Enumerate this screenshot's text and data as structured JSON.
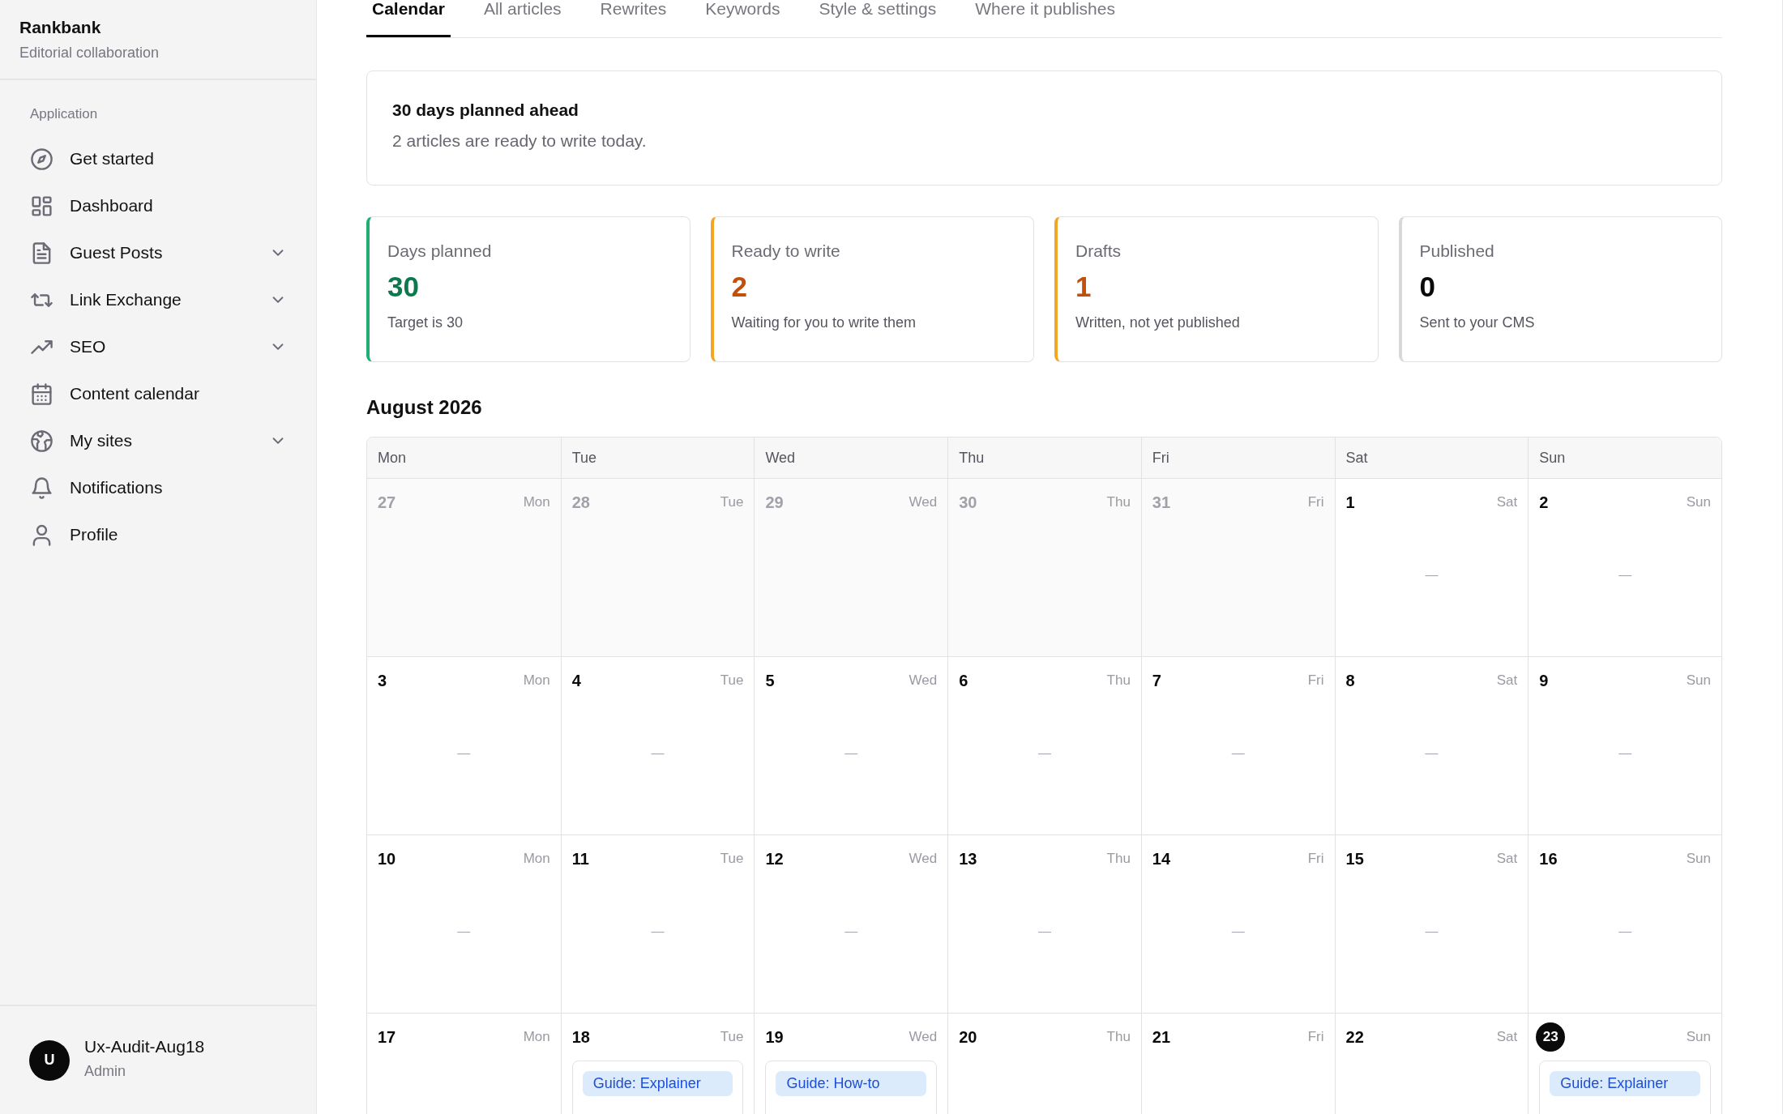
{
  "sidebar": {
    "brand": "Rankbank",
    "subtitle": "Editorial collaboration",
    "section": "Application",
    "items": [
      {
        "label": "Get started",
        "has_submenu": false
      },
      {
        "label": "Dashboard",
        "has_submenu": false
      },
      {
        "label": "Guest Posts",
        "has_submenu": true
      },
      {
        "label": "Link Exchange",
        "has_submenu": true
      },
      {
        "label": "SEO",
        "has_submenu": true
      },
      {
        "label": "Content calendar",
        "has_submenu": false
      },
      {
        "label": "My sites",
        "has_submenu": true
      },
      {
        "label": "Notifications",
        "has_submenu": false
      },
      {
        "label": "Profile",
        "has_submenu": false
      }
    ],
    "user": {
      "initial": "U",
      "name": "Ux-Audit-Aug18",
      "role": "Admin"
    }
  },
  "tabs": [
    {
      "label": "Calendar",
      "selected": true
    },
    {
      "label": "All articles",
      "selected": false
    },
    {
      "label": "Rewrites",
      "selected": false
    },
    {
      "label": "Keywords",
      "selected": false
    },
    {
      "label": "Style & settings",
      "selected": false
    },
    {
      "label": "Where it publishes",
      "selected": false
    }
  ],
  "summary": {
    "title": "30 days planned ahead",
    "text": "2 articles are ready to write today."
  },
  "stats": [
    {
      "label": "Days planned",
      "value": "30",
      "note": "Target is 30",
      "kind": "good"
    },
    {
      "label": "Ready to write",
      "value": "2",
      "note": "Waiting for you to write them",
      "kind": "pending"
    },
    {
      "label": "Drafts",
      "value": "1",
      "note": "Written, not yet published",
      "kind": "pending"
    },
    {
      "label": "Published",
      "value": "0",
      "note": "Sent to your CMS",
      "kind": "neutral"
    }
  ],
  "calendar": {
    "title": "August 2026",
    "weekdays": [
      "Mon",
      "Tue",
      "Wed",
      "Thu",
      "Fri",
      "Sat",
      "Sun"
    ],
    "weeks": [
      {
        "days": [
          {
            "day": "27",
            "weekday": "Mon",
            "in_month": false,
            "today": false
          },
          {
            "day": "28",
            "weekday": "Tue",
            "in_month": false,
            "today": false
          },
          {
            "day": "29",
            "weekday": "Wed",
            "in_month": false,
            "today": false
          },
          {
            "day": "30",
            "weekday": "Thu",
            "in_month": false,
            "today": false
          },
          {
            "day": "31",
            "weekday": "Fri",
            "in_month": false,
            "today": false
          },
          {
            "day": "1",
            "weekday": "Sat",
            "in_month": true,
            "today": false,
            "marker": "—"
          },
          {
            "day": "2",
            "weekday": "Sun",
            "in_month": true,
            "today": false,
            "marker": "—"
          }
        ]
      },
      {
        "days": [
          {
            "day": "3",
            "weekday": "Mon",
            "in_month": true,
            "today": false,
            "marker": "—"
          },
          {
            "day": "4",
            "weekday": "Tue",
            "in_month": true,
            "today": false,
            "marker": "—"
          },
          {
            "day": "5",
            "weekday": "Wed",
            "in_month": true,
            "today": false,
            "marker": "—"
          },
          {
            "day": "6",
            "weekday": "Thu",
            "in_month": true,
            "today": false,
            "marker": "—"
          },
          {
            "day": "7",
            "weekday": "Fri",
            "in_month": true,
            "today": false,
            "marker": "—"
          },
          {
            "day": "8",
            "weekday": "Sat",
            "in_month": true,
            "today": false,
            "marker": "—"
          },
          {
            "day": "9",
            "weekday": "Sun",
            "in_month": true,
            "today": false,
            "marker": "—"
          }
        ]
      },
      {
        "days": [
          {
            "day": "10",
            "weekday": "Mon",
            "in_month": true,
            "today": false,
            "marker": "—"
          },
          {
            "day": "11",
            "weekday": "Tue",
            "in_month": true,
            "today": false,
            "marker": "—"
          },
          {
            "day": "12",
            "weekday": "Wed",
            "in_month": true,
            "today": false,
            "marker": "—"
          },
          {
            "day": "13",
            "weekday": "Thu",
            "in_month": true,
            "today": false,
            "marker": "—"
          },
          {
            "day": "14",
            "weekday": "Fri",
            "in_month": true,
            "today": false,
            "marker": "—"
          },
          {
            "day": "15",
            "weekday": "Sat",
            "in_month": true,
            "today": false,
            "marker": "—"
          },
          {
            "day": "16",
            "weekday": "Sun",
            "in_month": true,
            "today": false,
            "marker": "—"
          }
        ]
      },
      {
        "days": [
          {
            "day": "17",
            "weekday": "Mon",
            "in_month": true,
            "today": false
          },
          {
            "day": "18",
            "weekday": "Tue",
            "in_month": true,
            "today": false,
            "articles": [
              {
                "tag": "Guide: Explainer"
              }
            ]
          },
          {
            "day": "19",
            "weekday": "Wed",
            "in_month": true,
            "today": false,
            "articles": [
              {
                "tag": "Guide: How-to"
              }
            ]
          },
          {
            "day": "20",
            "weekday": "Thu",
            "in_month": true,
            "today": false
          },
          {
            "day": "21",
            "weekday": "Fri",
            "in_month": true,
            "today": false
          },
          {
            "day": "22",
            "weekday": "Sat",
            "in_month": true,
            "today": false
          },
          {
            "day": "23",
            "weekday": "Sun",
            "in_month": true,
            "today": true,
            "articles": [
              {
                "tag": "Guide: Explainer"
              }
            ]
          }
        ]
      }
    ]
  }
}
